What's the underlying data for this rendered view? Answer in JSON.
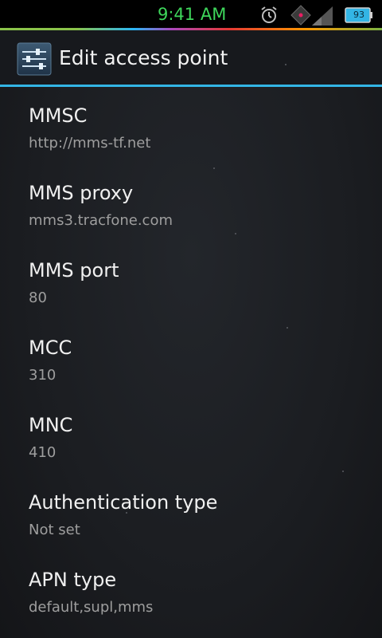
{
  "status_bar": {
    "time": "9:41 AM",
    "battery_level": "93",
    "icons": [
      "alarm-icon",
      "signal-icon",
      "battery-icon"
    ]
  },
  "action_bar": {
    "title": "Edit access point",
    "icon": "settings-sliders-icon"
  },
  "preferences": [
    {
      "title": "MMSC",
      "summary": "http://mms-tf.net"
    },
    {
      "title": "MMS proxy",
      "summary": "mms3.tracfone.com"
    },
    {
      "title": "MMS port",
      "summary": "80"
    },
    {
      "title": "MCC",
      "summary": "310"
    },
    {
      "title": "MNC",
      "summary": "410"
    },
    {
      "title": "Authentication type",
      "summary": "Not set"
    },
    {
      "title": "APN type",
      "summary": "default,supl,mms"
    }
  ],
  "colors": {
    "accent": "#33b5e5",
    "clock": "#3ed65b",
    "title_text": "#f0f0f0",
    "summary_text": "#9e9e9e"
  }
}
